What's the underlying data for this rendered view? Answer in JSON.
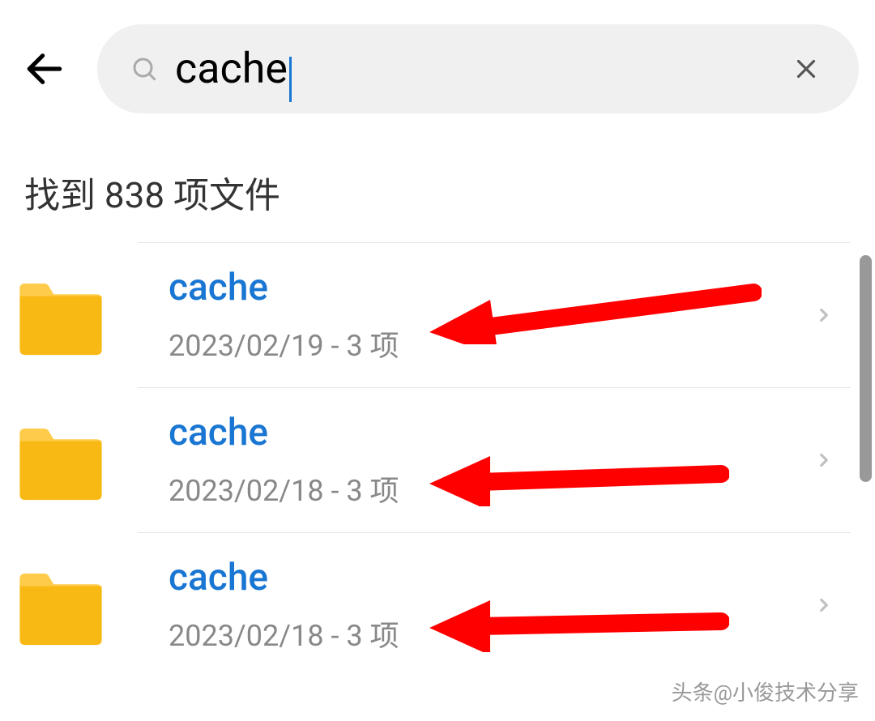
{
  "search": {
    "value": "cache"
  },
  "results": {
    "count_label": "找到 838 项文件",
    "items": [
      {
        "name": "cache",
        "meta": "2023/02/19 - 3 项"
      },
      {
        "name": "cache",
        "meta": "2023/02/18 - 3 项"
      },
      {
        "name": "cache",
        "meta": "2023/02/18 - 3 项"
      }
    ]
  },
  "watermark": "头条@小俊技术分享",
  "colors": {
    "accent": "#1976d2",
    "folder": "#f9b915",
    "arrow": "#ff0000"
  }
}
